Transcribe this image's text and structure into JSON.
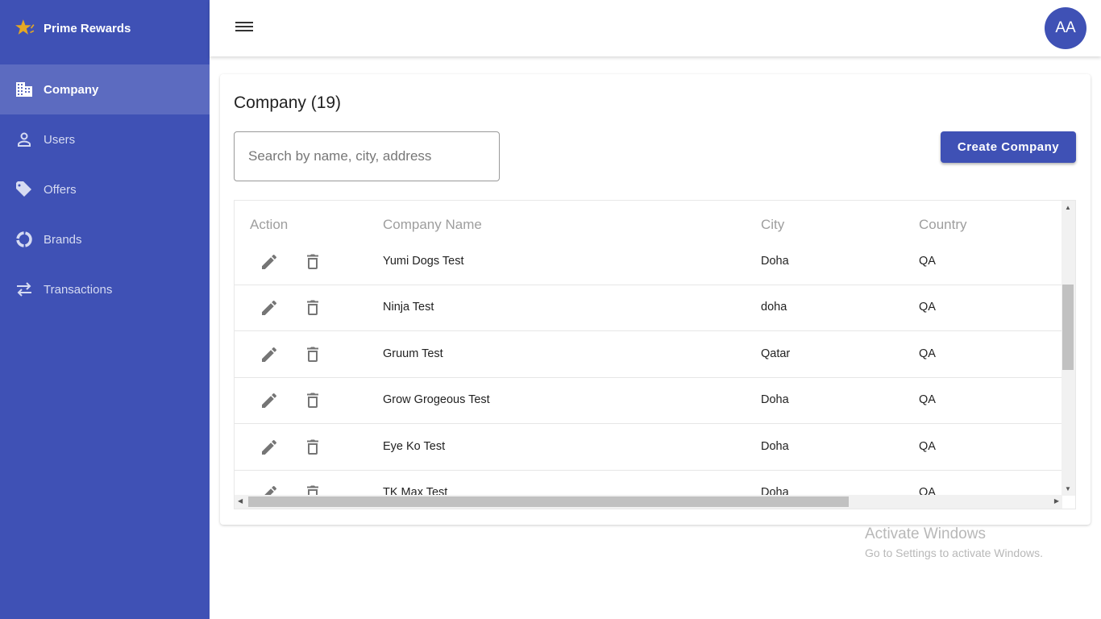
{
  "sidebar": {
    "brand": "Prime Rewards",
    "items": [
      {
        "label": "Company",
        "icon": "building-icon",
        "active": true
      },
      {
        "label": "Users",
        "icon": "person-icon"
      },
      {
        "label": "Offers",
        "icon": "tag-icon"
      },
      {
        "label": "Brands",
        "icon": "donut-icon"
      },
      {
        "label": "Transactions",
        "icon": "swap-icon"
      }
    ]
  },
  "header": {
    "avatar": "AA"
  },
  "main": {
    "title": "Company (19)",
    "search_placeholder": "Search by name, city, address",
    "create_label": "Create Company",
    "columns": [
      "Action",
      "Company Name",
      "City",
      "Country"
    ],
    "rows": [
      [
        "Yumi Dogs Test",
        "Doha",
        "QA"
      ],
      [
        "Ninja Test",
        "doha",
        "QA"
      ],
      [
        "Gruum Test",
        "Qatar",
        "QA"
      ],
      [
        "Grow Grogeous Test",
        "Doha",
        "QA"
      ],
      [
        "Eye Ko Test",
        "Doha",
        "QA"
      ],
      [
        "TK Max Test",
        "Doha",
        "QA"
      ]
    ]
  },
  "watermark": {
    "title": "Activate Windows",
    "subtitle": "Go to Settings to activate Windows."
  },
  "colors": {
    "primary": "#3f51b5",
    "active_item": "#5c6bc0"
  }
}
